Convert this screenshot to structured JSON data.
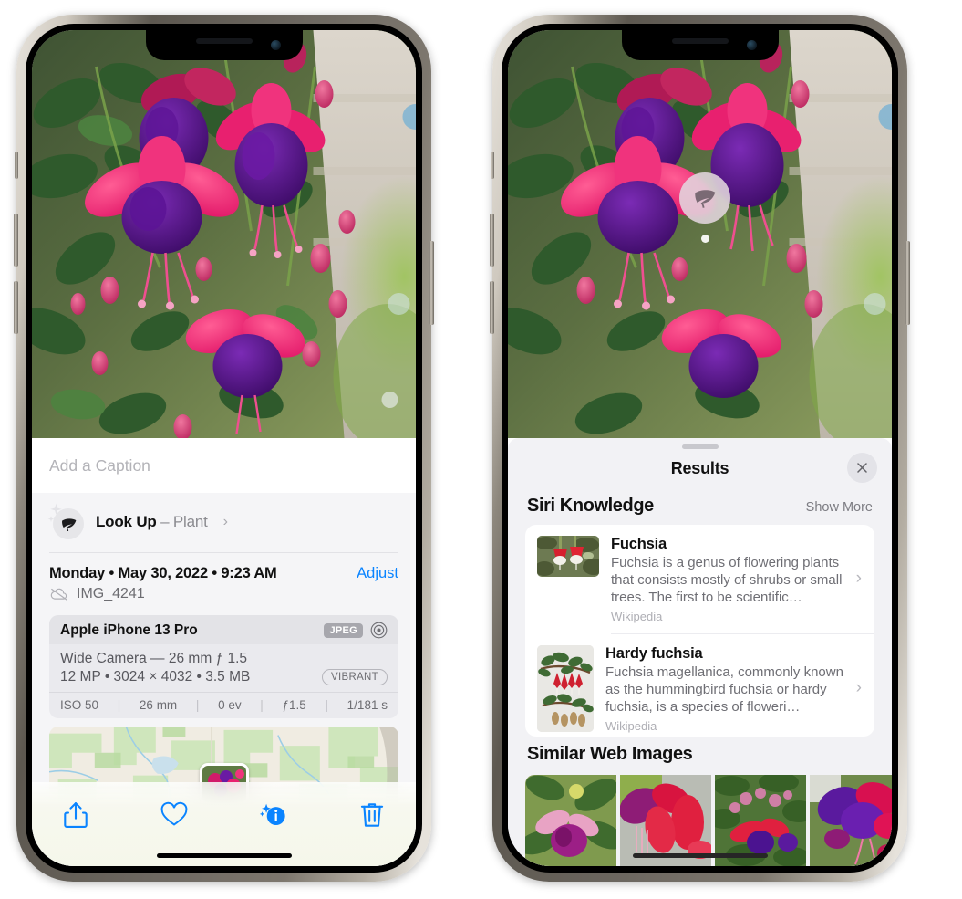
{
  "left_phone": {
    "caption": {
      "placeholder": "Add a Caption",
      "value": ""
    },
    "lookup": {
      "label": "Look Up",
      "dash": " – ",
      "subject": "Plant",
      "chevron": "›",
      "icon": "leaf-icon"
    },
    "meta": {
      "date": "Monday • May 30, 2022 • 9:23 AM",
      "adjust_label": "Adjust",
      "filename": "IMG_4241",
      "cloud_icon": "icloud-slash-icon"
    },
    "exif": {
      "device": "Apple iPhone 13 Pro",
      "format_badge": "JPEG",
      "raw_icon": "raw-circle-icon",
      "lens_line": "Wide Camera — 26 mm ƒ 1.5",
      "size_line": "12 MP • 3024 × 4032 • 3.5 MB",
      "style_badge": "VIBRANT",
      "stats": [
        "ISO 50",
        "26 mm",
        "0 ev",
        "ƒ1.5",
        "1/181 s"
      ],
      "separator": "|"
    },
    "toolbar": [
      {
        "name": "share-button",
        "icon": "share-icon"
      },
      {
        "name": "favorite-button",
        "icon": "heart-icon"
      },
      {
        "name": "info-button",
        "icon": "info-sparkle-icon"
      },
      {
        "name": "delete-button",
        "icon": "trash-icon"
      }
    ]
  },
  "right_phone": {
    "pin": {
      "icon": "leaf-icon"
    },
    "sheet": {
      "title": "Results",
      "close_icon": "close-icon"
    },
    "siri_knowledge": {
      "title": "Siri Knowledge",
      "action": "Show More",
      "items": [
        {
          "title": "Fuchsia",
          "description": "Fuchsia is a genus of flowering plants that consists mostly of shrubs or small trees. The first to be scientific…",
          "source": "Wikipedia",
          "chevron": "›",
          "thumb": "fuchsia-red-flowers-thumb"
        },
        {
          "title": "Hardy fuchsia",
          "description": "Fuchsia magellanica, commonly known as the hummingbird fuchsia or hardy fuchsia, is a species of floweri…",
          "source": "Wikipedia",
          "chevron": "›",
          "thumb": "hardy-fuchsia-specimen-thumb"
        }
      ]
    },
    "similar_web_images": {
      "title": "Similar Web Images",
      "items": [
        {
          "name": "web-image-1"
        },
        {
          "name": "web-image-2"
        },
        {
          "name": "web-image-3"
        },
        {
          "name": "web-image-4"
        }
      ]
    }
  },
  "colors": {
    "accent_blue": "#0a84ff",
    "sheet_gray": "#f2f2f5",
    "card_white": "#ffffff",
    "secondary_text": "#6e6e74"
  }
}
